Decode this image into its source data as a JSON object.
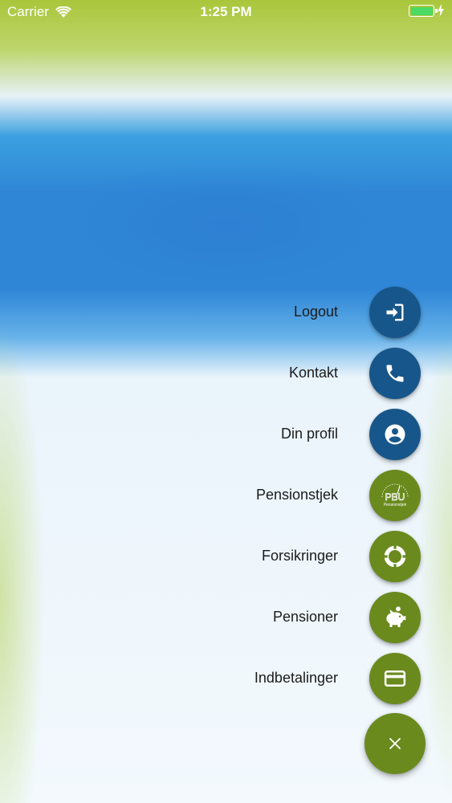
{
  "status_bar": {
    "carrier": "Carrier",
    "time": "1:25 PM",
    "battery_color": "#4cd964"
  },
  "colors": {
    "blue_fab": "#17568a",
    "green_fab": "#6a8a1e",
    "label": "#1b1b1b"
  },
  "menu": {
    "items": [
      {
        "label": "Logout",
        "icon": "logout-icon"
      },
      {
        "label": "Kontakt",
        "icon": "phone-icon"
      },
      {
        "label": "Din profil",
        "icon": "profile-icon"
      },
      {
        "label": "Pensionstjek",
        "icon": "pbu-pensionstjek-logo-icon",
        "logo_title": "PBU",
        "logo_subtitle": "Pensionstjek"
      },
      {
        "label": "Forsikringer",
        "icon": "lifebuoy-icon"
      },
      {
        "label": "Pensioner",
        "icon": "piggy-bank-icon"
      },
      {
        "label": "Indbetalinger",
        "icon": "credit-card-icon"
      }
    ],
    "close_icon": "close-icon"
  }
}
